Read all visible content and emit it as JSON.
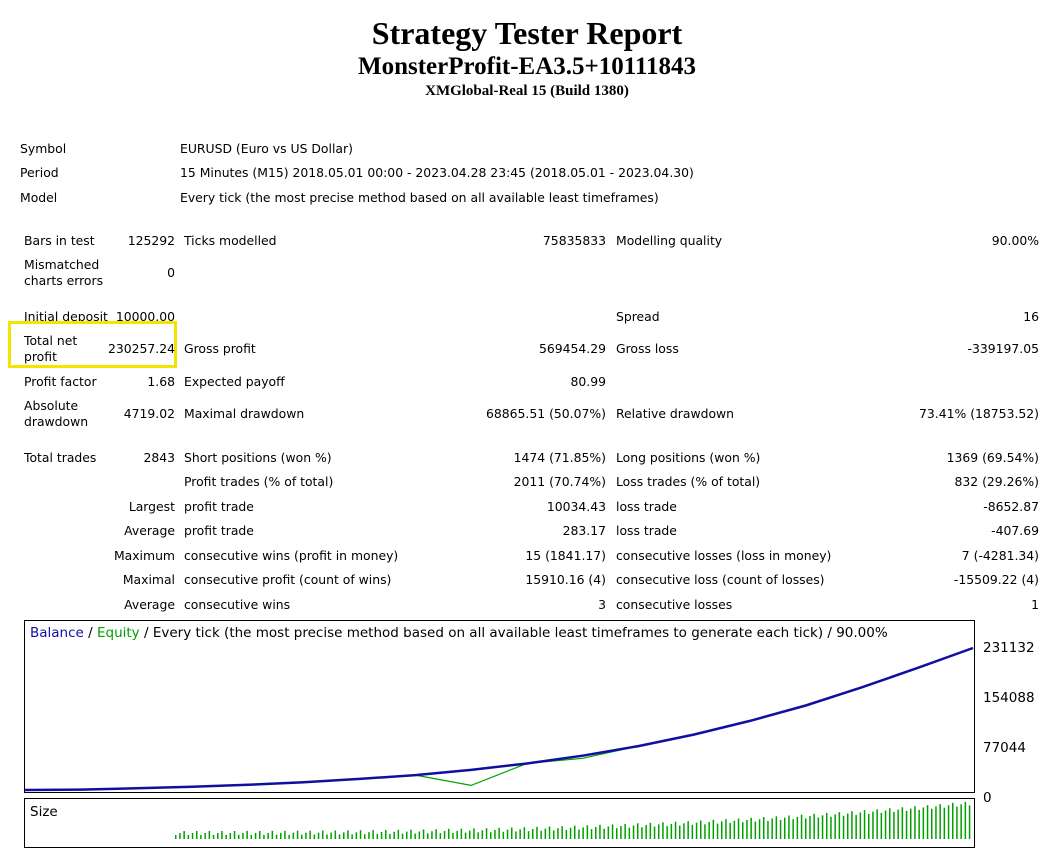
{
  "header": {
    "title": "Strategy Tester Report",
    "ea_name": "MonsterProfit-EA3.5+10111843",
    "server": "XMGlobal-Real 15 (Build 1380)"
  },
  "info": {
    "symbol_label": "Symbol",
    "symbol_value": "EURUSD (Euro vs US Dollar)",
    "period_label": "Period",
    "period_value": "15 Minutes (M15) 2018.05.01 00:00 - 2023.04.28 23:45 (2018.05.01 - 2023.04.30)",
    "model_label": "Model",
    "model_value": "Every tick (the most precise method based on all available least timeframes)"
  },
  "stats": {
    "bars_label": "Bars in test",
    "bars_value": "125292",
    "ticks_label": "Ticks modelled",
    "ticks_value": "75835833",
    "quality_label": "Modelling quality",
    "quality_value": "90.00%",
    "mismatch_label_1": "Mismatched",
    "mismatch_label_2": "charts errors",
    "mismatch_value": "0",
    "deposit_label": "Initial deposit",
    "deposit_value": "10000.00",
    "spread_label": "Spread",
    "spread_value": "16",
    "net_label_1": "Total net",
    "net_label_2": "profit",
    "net_value": "230257.24",
    "gross_profit_label": "Gross profit",
    "gross_profit_value": "569454.29",
    "gross_loss_label": "Gross loss",
    "gross_loss_value": "-339197.05",
    "pf_label": "Profit factor",
    "pf_value": "1.68",
    "payoff_label": "Expected payoff",
    "payoff_value": "80.99",
    "abs_dd_label_1": "Absolute",
    "abs_dd_label_2": "drawdown",
    "abs_dd_value": "4719.02",
    "max_dd_label": "Maximal drawdown",
    "max_dd_value": "68865.51 (50.07%)",
    "rel_dd_label": "Relative drawdown",
    "rel_dd_value": "73.41% (18753.52)",
    "trades_label": "Total trades",
    "trades_value": "2843",
    "short_label": "Short positions (won %)",
    "short_value": "1474 (71.85%)",
    "long_label": "Long positions (won %)",
    "long_value": "1369 (69.54%)",
    "profit_trades_label": "Profit trades (% of total)",
    "profit_trades_value": "2011 (70.74%)",
    "loss_trades_label": "Loss trades (% of total)",
    "loss_trades_value": "832 (29.26%)",
    "largest_label": "Largest",
    "largest_profit_label": "profit trade",
    "largest_profit_value": "10034.43",
    "largest_loss_label": "loss trade",
    "largest_loss_value": "-8652.87",
    "average_label": "Average",
    "avg_profit_label": "profit trade",
    "avg_profit_value": "283.17",
    "avg_loss_label": "loss trade",
    "avg_loss_value": "-407.69",
    "maximum_label": "Maximum",
    "max_cons_wins_label": "consecutive wins (profit in money)",
    "max_cons_wins_value": "15 (1841.17)",
    "max_cons_losses_label": "consecutive losses (loss in money)",
    "max_cons_losses_value": "7 (-4281.34)",
    "maximal_label": "Maximal",
    "maximal_cons_profit_label": "consecutive profit (count of wins)",
    "maximal_cons_profit_value": "15910.16 (4)",
    "maximal_cons_loss_label": "consecutive loss (count of losses)",
    "maximal_cons_loss_value": "-15509.22 (4)",
    "average2_label": "Average",
    "avg_cons_wins_label": "consecutive wins",
    "avg_cons_wins_value": "3",
    "avg_cons_losses_label": "consecutive losses",
    "avg_cons_losses_value": "1"
  },
  "chart": {
    "legend_balance": "Balance",
    "legend_sep1": " / ",
    "legend_equity": "Equity",
    "legend_rest": " / Every tick (the most precise method based on all available least timeframes to generate each tick) / 90.00%",
    "y_ticks": [
      "231132",
      "154088",
      "77044",
      "0"
    ],
    "size_label": "Size",
    "balance_color": "#1010a0",
    "equity_color": "#00a000"
  },
  "chart_data": {
    "type": "line",
    "series": [
      {
        "name": "Balance",
        "values": [
          10000,
          11500,
          13500,
          16000,
          19000,
          23000,
          28000,
          34000,
          42000,
          52000,
          64000,
          79000,
          97000,
          118000,
          142000,
          170000,
          200000,
          231132
        ]
      },
      {
        "name": "Equity",
        "values": [
          10000,
          11500,
          13500,
          16000,
          19000,
          23000,
          28000,
          34000,
          18000,
          52000,
          60000,
          79000,
          97000,
          118000,
          142000,
          170000,
          200000,
          231132
        ]
      }
    ],
    "ylim": [
      0,
      231132
    ],
    "y_ticks": [
      0,
      77044,
      154088,
      231132
    ]
  }
}
